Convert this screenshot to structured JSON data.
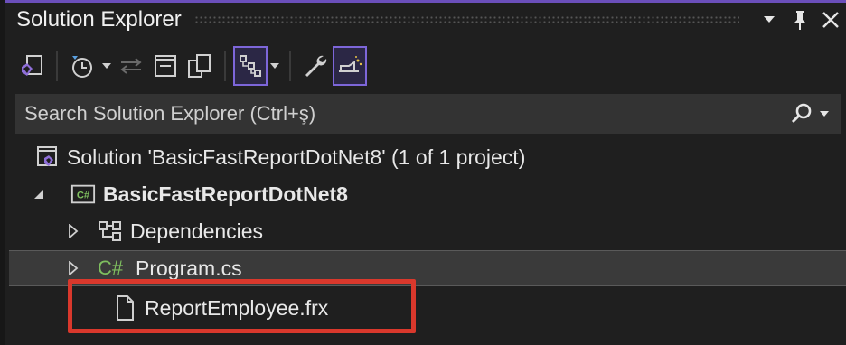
{
  "window": {
    "title": "Solution Explorer"
  },
  "toolbar": {
    "buttons": [
      {
        "icon": "vs-solution-switch-icon",
        "active": false
      },
      {
        "icon": "pending-changes-clock-icon",
        "active": false
      },
      {
        "icon": "sync-with-active-document-icon",
        "active": false
      },
      {
        "icon": "collapse-all-icon",
        "active": false
      },
      {
        "icon": "show-all-files-icon",
        "active": false
      },
      {
        "icon": "tree-view-icon",
        "active": true
      },
      {
        "icon": "properties-wrench-icon",
        "active": false
      },
      {
        "icon": "preview-selected-items-icon",
        "active": true
      }
    ]
  },
  "search": {
    "placeholder": "Search Solution Explorer (Ctrl+ş)"
  },
  "tree": {
    "solution_label": "Solution 'BasicFastReportDotNet8' (1 of 1 project)",
    "project_label": "BasicFastReportDotNet8",
    "project_badge": "C#",
    "dependencies_label": "Dependencies",
    "program_label": "Program.cs",
    "program_badge": "C#",
    "report_label": "ReportEmployee.frx"
  },
  "colors": {
    "accent": "#7d66d9",
    "highlight_box": "#d9382c",
    "csharp_green": "#7fbf5f",
    "vs_purple": "#8f6fd8"
  }
}
